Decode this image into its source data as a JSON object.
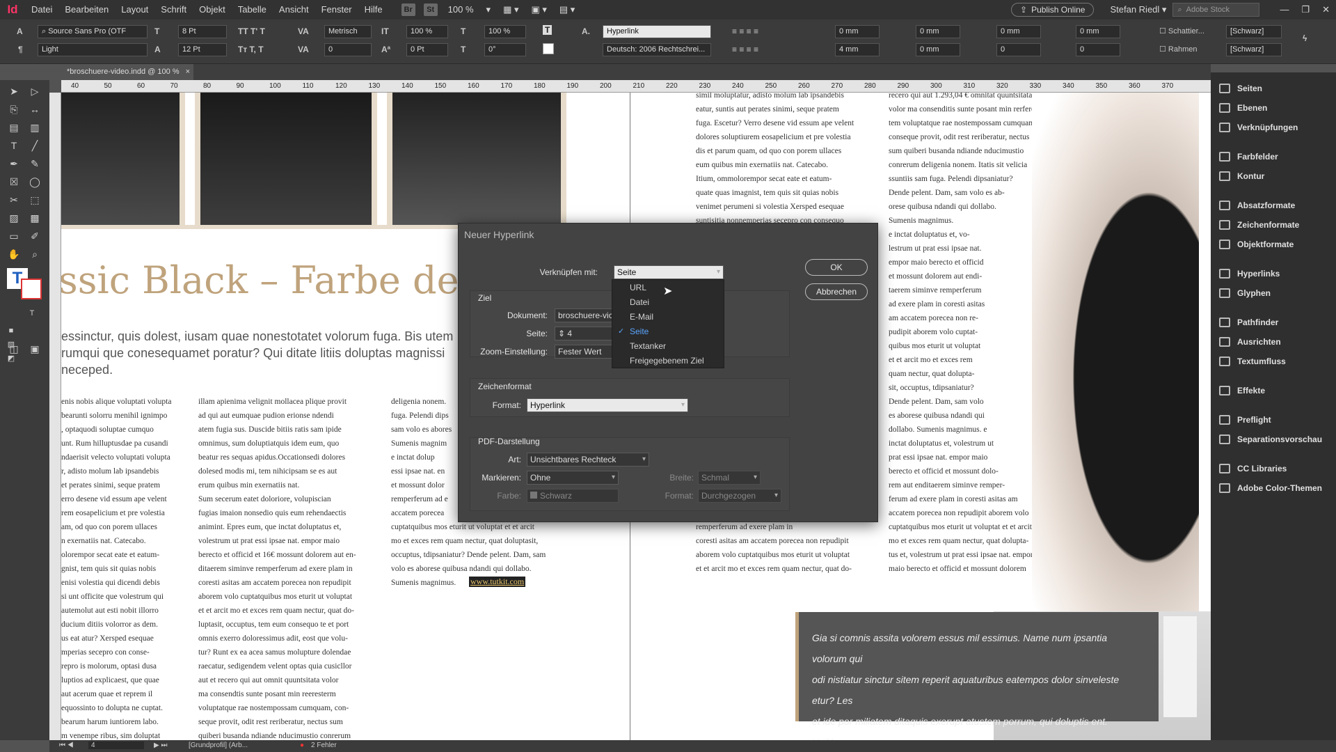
{
  "app": {
    "logo": "Id"
  },
  "menubar": {
    "items": [
      "Datei",
      "Bearbeiten",
      "Layout",
      "Schrift",
      "Objekt",
      "Tabelle",
      "Ansicht",
      "Fenster",
      "Hilfe"
    ],
    "badges": [
      "Br",
      "St"
    ],
    "zoom": "100 %",
    "publish": "Publish Online",
    "user": "Stefan Riedl",
    "search_placeholder": "Adobe Stock"
  },
  "control": {
    "font_family": "Source Sans Pro (OTF",
    "font_style": "Light",
    "font_size": "8 Pt",
    "leading": "12 Pt",
    "kerning": "Metrisch",
    "tracking": "0",
    "vscale": "100 %",
    "hscale": "100 %",
    "baseline": "0 Pt",
    "skew": "0°",
    "char_style": "Hyperlink",
    "language": "Deutsch: 2006 Rechtschrei...",
    "indents": [
      "0 mm",
      "0 mm",
      "0 mm",
      "0 mm"
    ],
    "indents2": [
      "4 mm",
      "0 mm",
      "0",
      "0"
    ],
    "shading_label": "Schattier...",
    "frame_label": "Rahmen",
    "swatch": "[Schwarz]"
  },
  "document": {
    "tab": "*broschuere-video.indd @ 100 %",
    "ruler_marks": [
      "40",
      "50",
      "60",
      "70",
      "80",
      "90",
      "100",
      "110",
      "120",
      "130",
      "140",
      "150",
      "160",
      "170",
      "180",
      "190",
      "200",
      "210",
      "220",
      "230",
      "240",
      "250",
      "260",
      "270",
      "280",
      "290",
      "300",
      "310",
      "320",
      "330",
      "340",
      "350",
      "360",
      "370"
    ]
  },
  "layout": {
    "headline": "ssic Black – Farbe des Sor",
    "lead": "essinctur, quis dolest, iusam quae nonestotatet volorum fuga. Bis utem\nrumqui que conesequamet poratur? Qui ditate litiis doluptas magnissi\nneceped.",
    "col1": "enis nobis alique voluptati volupta\nbearunti solorru menihil ignimpo\n, optaquodi soluptae cumquo\nunt. Rum hilluptusdae pa cusandi\nndaerisit velecto voluptati volupta\nr, adisto molum lab ipsandebis\net perates sinimi, seque pratem\nerro desene vid essum ape velent\nrem eosapelicium et pre volestia\nam, od quo con porem ullaces\nn exernatiis nat. Catecabo.\nolorempor secat eate et eatum-\ngnist, tem quis sit quias nobis\nenisi volestia qui dicendi debis\nsi unt officite que volestrum qui\nautemolut aut esti nobit illorro\nducium ditiis volorror as dem.\nus eat atur? Xersped esequae\nmperias secepro con conse-\nrepro is molorum, optasi dusa\nluptios ad explicaest, que quae\naut acerum quae et reprem il\nequossinto to dolupta ne cuptat.\nbearum harum iuntiorem labo.\nm venempe ribus, sim doluptat",
    "col2": "illam apienima velignit mollacea plique provit\nad qui aut eumquae pudion erionse ndendi\natem fugia sus. Duscide bitiis ratis sam ipide\nomnimus, sum doluptiatquis idem eum, quo\nbeatur res sequas apidus.Occationsedi dolores\ndolesed modis mi, tem nihicipsam se es aut\nerum quibus min exernatiis nat.\n    Sum secerum eatet doloriore, volupiscian\nfugias imaion nonsedio quis eum rehendaectis\nanimint. Epres eum, que inctat doluptatus et,\nvolestrum ut prat essi ipsae nat. empor maio\nberecto et officid et 16€ mossunt dolorem aut en-\nditaerem siminve remperferum ad exere plam in\ncoresti asitas am accatem porecea non repudipit\naborem volo cuptatquibus mos eturit ut voluptat\net et arcit mo et exces rem quam nectur, quat do-\nluptasit, occuptus, tem eum consequo te et port\nomnis exerro doloressimus adit, eost que volu-\ntur? Runt ex ea acea samus molupture dolendae\nraecatur, sedigendem velent optas quia cusicllor\naut et recero qui aut omnit quuntsitata volor\nma consendtis sunte posant min reeresterm\nvoluptatque rae nostempossam cumquam, con-\nseque provit, odit rest reriberatur, nectus sum\nquiberi busanda ndiande nducimustio conrerum",
    "col3": "deligenia nonem.\nfuga. Pelendi dips\nsam volo es abores\nSumenis magnim\n    e inctat dolup\nessi ipsae nat. en\net mossunt dolor\nremperferum ad e\naccatem porecea\ncuptatquibus mos eturit ut voluptat et et arcit\nmo et exces rem quam nectur, quat doluptasit,\noccuptus, tdipsaniatur? Dende pelent. Dam, sam\nvolo es aborese quibusa ndandi qui dollabo.\nSumenis magnimus.",
    "link": "www.tutkit.com",
    "col4": "simil moluptatur, adisto molum lab ipsandebis\neatur, suntis aut perates sinimi, seque pratem\nfuga. Escetur? Verro desene vid essum ape velent\ndolores soluptiurem eosapelicium et pre volestia\ndis et parum quam, od quo con porem ullaces\neum quibus min exernatiis nat. Catecabo.\n    Itium, ommolorempor secat eate et eatum-\nquate quas imagnist, tem quis sit quias nobis\nvenimet perumeni si volestia Xersped esequae\nsuntisitia nonnemperias secepro con consequo",
    "col4b": "remperferum ad exere plam in\ncoresti asitas am accatem porecea non repudipit\naborem volo cuptatquibus mos eturit ut voluptat\net et arcit mo et exces rem quam nectur, quat do-",
    "col5": "recero qui aut 1.293,04 € omnitat quuntsitata\nvolor ma consenditis sunte posant min rerferes-\ntem voluptatque rae nostempossam cumquam,\nconseque provit, odit rest reriberatur, nectus\nsum quiberi busanda ndiande nducimustio\nconrerum deligenia nonem. Itatis sit velicia\nssuntiis sam fuga. Pelendi dipsaniatur?\nDende pelent. Dam, sam volo es ab-\norese quibusa ndandi qui dollabo.\nSumenis magnimus.\n    e inctat doluptatus et, vo-\nlestrum ut prat essi ipsae nat.\nempor maio berecto et officid\net mossunt dolorem aut endi-\ntaerem siminve remperferum\nad exere plam in coresti asitas\nam accatem porecea non re-\npudipit aborem volo cuptat-\nquibus mos eturit ut voluptat\net et arcit mo et exces rem\nquam nectur, quat dolupta-\nsit, occuptus, tdipsaniatur?\nDende pelent. Dam, sam volo\nes aborese quibusa ndandi qui\ndollabo. Sumenis magnimus. e\ninctat doluptatus et, volestrum ut\nprat essi ipsae nat. empor maio\nberecto et officid et mossunt dolo-\nrem aut enditaerem siminve remper-\nferum ad exere plam in coresti asitas am\naccatem porecea non repudipit aborem volo\ncuptatquibus mos eturit ut voluptat et et arcit\nmo et exces rem quam nectur, quat dolupta-\ntus et, volestrum ut prat essi ipsae nat. empor\nmaio berecto et officid et mossunt dolorem",
    "quote": "Gia si comnis assita volorem essus mil essimus. Name num ipsantia volorum qui\nodi nistiatur sinctur sitem reperit aquaturibus eatempos dolor sinveleste etur? Les\net ide por miliatem ditaquis exerupt atustem porrum, qui doluptis ent. Ucilibus\nincitat quiaept verundam."
  },
  "panel": {
    "items": [
      "Seiten",
      "Ebenen",
      "Verknüpfungen",
      "Farbfelder",
      "Kontur",
      "Absatzformate",
      "Zeichenformate",
      "Objektformate",
      "Hyperlinks",
      "Glyphen",
      "Pathfinder",
      "Ausrichten",
      "Textumfluss",
      "Effekte",
      "Preflight",
      "Separationsvorschau",
      "CC Libraries",
      "Adobe Color-Themen"
    ]
  },
  "status": {
    "page": "4",
    "profile": "[Grundprofil] (Arb...",
    "errors": "2 Fehler"
  },
  "dialog": {
    "title": "Neuer Hyperlink",
    "link_with_label": "Verknüpfen mit:",
    "link_with_value": "Seite",
    "ok": "OK",
    "cancel": "Abbrechen",
    "target_section": "Ziel",
    "document_label": "Dokument:",
    "document_value": "broschuere-vic",
    "page_label": "Seite:",
    "page_value": "4",
    "zoom_label": "Zoom-Einstellung:",
    "zoom_value": "Fester Wert",
    "charstyle_section": "Zeichenformat",
    "format_label": "Format:",
    "format_value": "Hyperlink",
    "pdf_section": "PDF-Darstellung",
    "type_label": "Art:",
    "type_value": "Unsichtbares Rechteck",
    "highlight_label": "Markieren:",
    "highlight_value": "Ohne",
    "width_label": "Breite:",
    "width_value": "Schmal",
    "color_label": "Farbe:",
    "color_value": "Schwarz",
    "style_label": "Format:",
    "style_value": "Durchgezogen",
    "options": [
      "URL",
      "Datei",
      "E-Mail",
      "Seite",
      "Textanker",
      "Freigegebenem Ziel"
    ]
  }
}
